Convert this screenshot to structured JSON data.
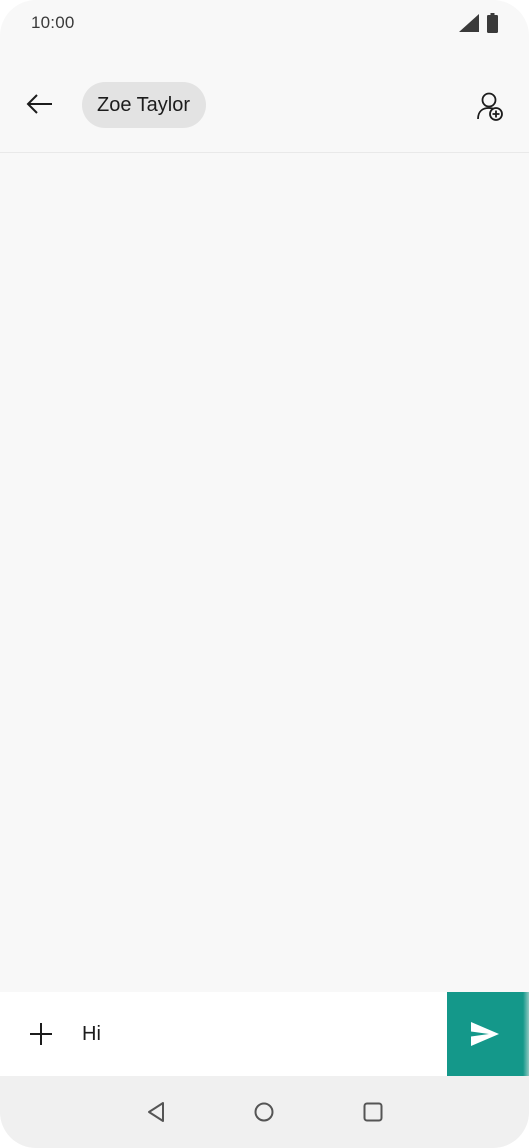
{
  "status_bar": {
    "time": "10:00",
    "icons": [
      "signal-icon",
      "battery-icon"
    ]
  },
  "app_bar": {
    "back_icon": "arrow-left-icon",
    "recipient": "Zoe Taylor",
    "add_contact_icon": "person-add-icon"
  },
  "compose": {
    "attach_icon": "plus-icon",
    "message_text": "Hi",
    "send_icon": "send-icon",
    "send_color": "#14988a"
  },
  "nav_bar": {
    "icons": [
      "nav-back-icon",
      "nav-home-icon",
      "nav-recents-icon"
    ]
  }
}
